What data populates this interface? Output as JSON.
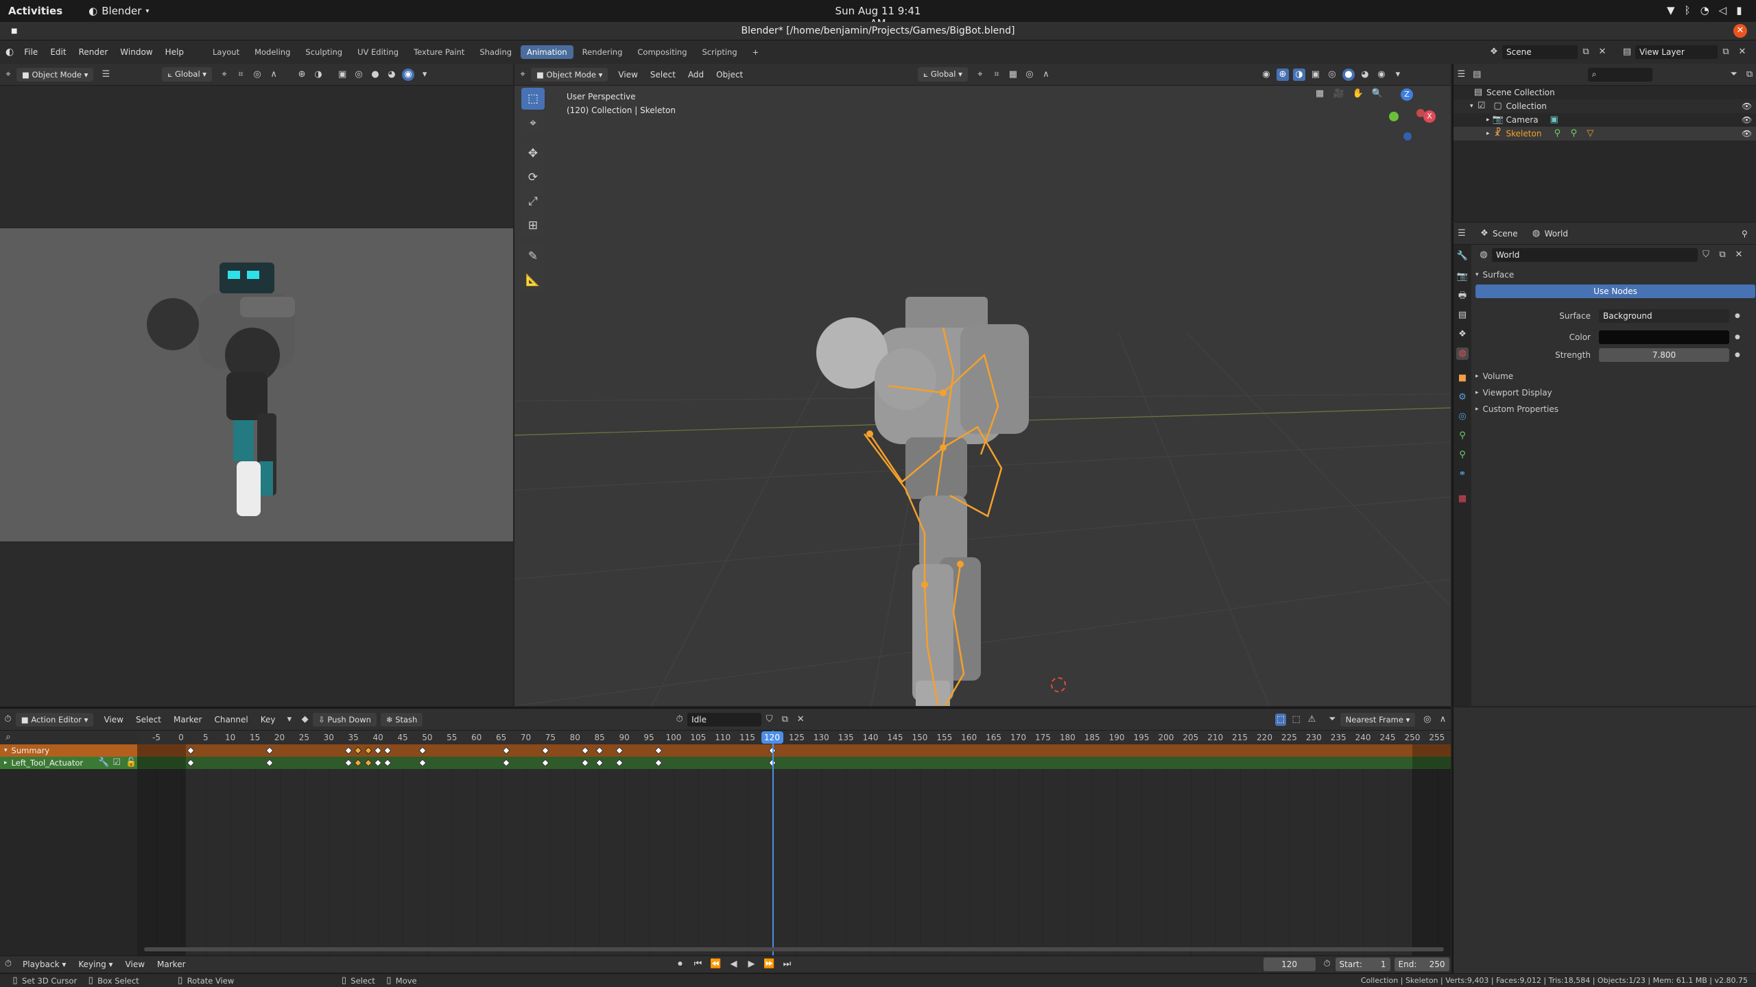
{
  "gnome": {
    "activities": "Activities",
    "app": "Blender",
    "clock": "Sun Aug 11   9:41 AM"
  },
  "window": {
    "title": "Blender* [/home/benjamin/Projects/Games/BigBot.blend]"
  },
  "menubar": {
    "items": [
      "File",
      "Edit",
      "Render",
      "Window",
      "Help"
    ]
  },
  "workspaces": {
    "tabs": [
      "Layout",
      "Modeling",
      "Sculpting",
      "UV Editing",
      "Texture Paint",
      "Shading",
      "Animation",
      "Rendering",
      "Compositing",
      "Scripting"
    ],
    "active": "Animation",
    "add": "+"
  },
  "scene": {
    "label": "Scene",
    "view_layer": "View Layer"
  },
  "left_view": {
    "mode": "Object Mode",
    "orientation": "Global"
  },
  "viewport": {
    "mode": "Object Mode",
    "menus": [
      "View",
      "Select",
      "Add",
      "Object"
    ],
    "orientation": "Global",
    "overlay_line1": "User Perspective",
    "overlay_line2": "(120) Collection | Skeleton",
    "gizmo": {
      "z": "Z",
      "x": "X",
      "y": "Y"
    }
  },
  "outliner": {
    "root": "Scene Collection",
    "collection": "Collection",
    "camera": "Camera",
    "skeleton": "Skeleton"
  },
  "properties": {
    "scene": "Scene",
    "world": "World",
    "world_field": "World",
    "surface_section": "Surface",
    "use_nodes": "Use Nodes",
    "surface_label": "Surface",
    "surface_value": "Background",
    "color_label": "Color",
    "strength_label": "Strength",
    "strength_value": "7.800",
    "sections": [
      "Volume",
      "Viewport Display",
      "Custom Properties"
    ]
  },
  "action_editor": {
    "type": "Action Editor",
    "menus": [
      "View",
      "Select",
      "Marker",
      "Channel",
      "Key"
    ],
    "push_down": "Push Down",
    "stash": "Stash",
    "action": "Idle",
    "snap": "Nearest Frame",
    "current_frame": 120,
    "frame_start": -5,
    "frame_end": 255,
    "frame_step": 5,
    "channels": [
      "Summary",
      "Left_Tool_Actuator"
    ],
    "keyframes": [
      2,
      18,
      34,
      36,
      38,
      40,
      42,
      49,
      66,
      74,
      82,
      85,
      89,
      97,
      120
    ],
    "selected_keyframes": [
      36,
      38
    ],
    "range_end": 250
  },
  "timeline": {
    "menus": [
      "Playback",
      "Keying",
      "View",
      "Marker"
    ],
    "frame": "120",
    "start_label": "Start:",
    "start": "1",
    "end_label": "End:",
    "end": "250"
  },
  "statusbar": {
    "hints": [
      "Set 3D Cursor",
      "Box Select",
      "Rotate View",
      "Select",
      "Move"
    ],
    "stats": "Collection | Skeleton | Verts:9,403 | Faces:9,012 | Tris:18,584 | Objects:1/23 | Mem: 61.1 MB | v2.80.75"
  },
  "colors": {
    "accent": "#4772b3",
    "selected": "#f3a73a",
    "summary": "#b35f1d",
    "channel": "#3b7a34",
    "playhead": "#4d8fe8"
  }
}
